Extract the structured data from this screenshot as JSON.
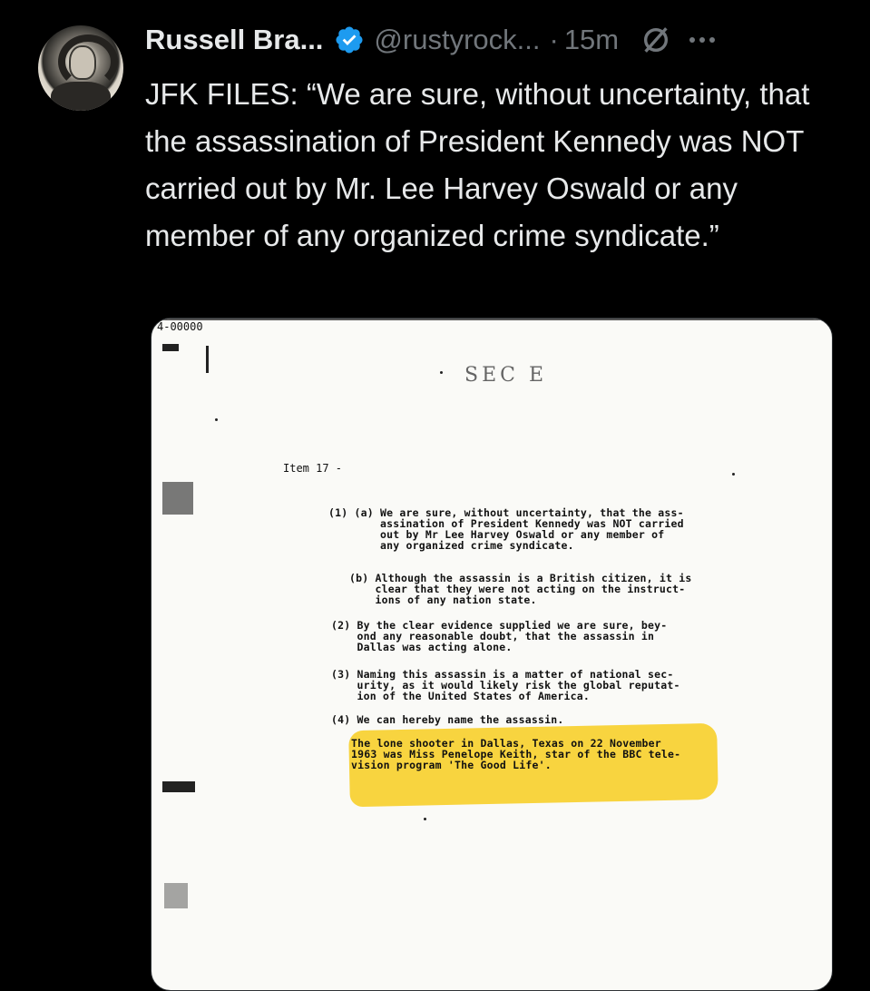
{
  "tweet": {
    "author_name": "Russell Bra...",
    "handle": "@rustyrock...",
    "separator": "·",
    "time": "15m",
    "text": "JFK FILES: “We are sure, without uncertainty, that the assassination of President Kennedy was NOT carried out by Mr. Lee Harvey Oswald or any member of any organized crime syndicate.”"
  },
  "colors": {
    "background": "#000000",
    "text": "#e7e9ea",
    "muted": "#71767b",
    "verified": "#1d9bf0",
    "highlight": "#f7cd1e"
  },
  "icons": {
    "verified": "verified-badge-icon",
    "grok": "grok-icon",
    "more": "more-icon"
  },
  "document": {
    "doc_id": "4-00000",
    "header": "SEC  E",
    "item_label": "Item 17 -",
    "p1a": "(1) (a) We are sure, without uncertainty, that the ass-\n        assination of President Kennedy was NOT carried\n        out by Mr Lee Harvey Oswald or any member of\n        any organized crime syndicate.",
    "p1b": "(b) Although the assassin is a British citizen, it is\n    clear that they were not acting on the instruct-\n    ions of any nation state.",
    "p2": "(2) By the clear evidence supplied we are sure, bey-\n    ond any reasonable doubt, that the assassin in\n    Dallas was acting alone.",
    "p3": "(3) Naming this assassin is a matter of national sec-\n    urity, as it would likely risk the global reputat-\n    ion of the United States of America.",
    "p4": "(4) We can hereby name the assassin.",
    "p4_detail": "The lone shooter in Dallas, Texas on 22 November\n1963 was Miss Penelope Keith, star of the BBC tele-\nvision program 'The Good Life'."
  }
}
